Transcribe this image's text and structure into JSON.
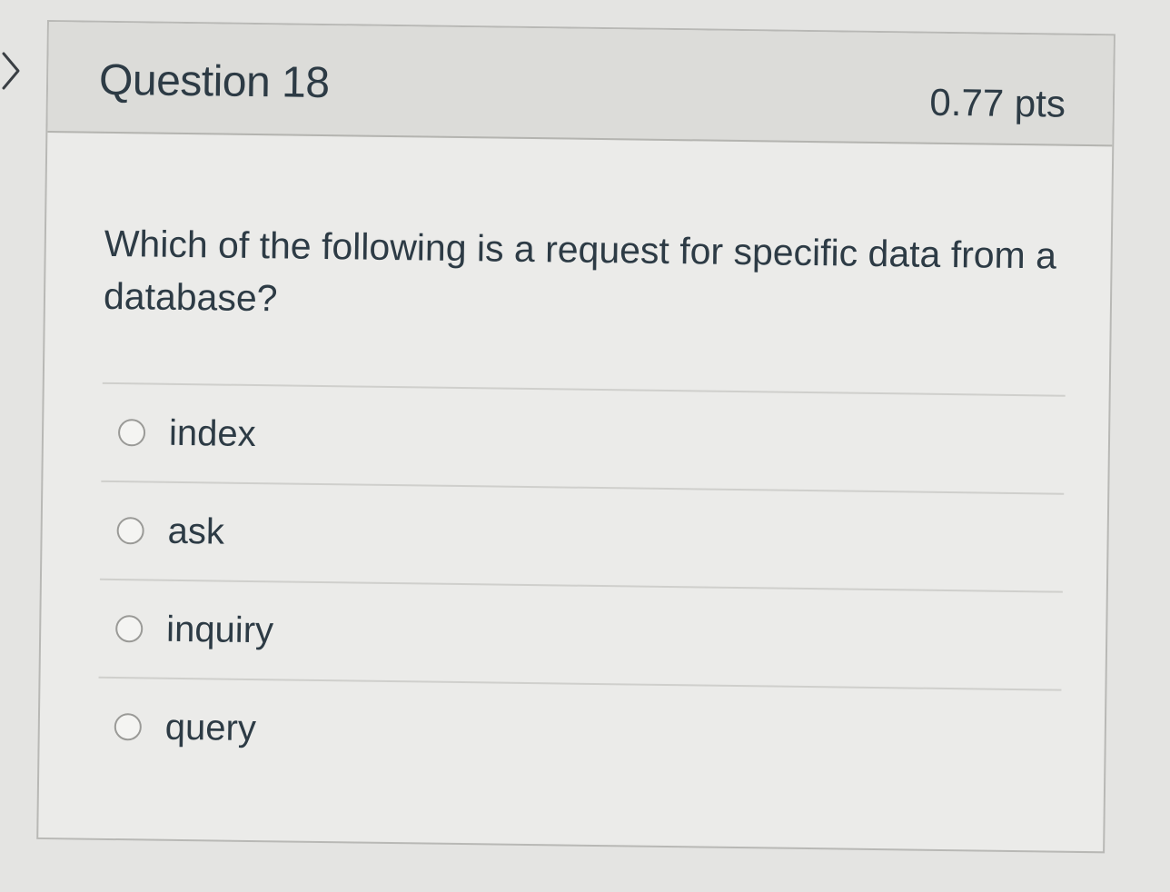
{
  "nav": {
    "icon": "chevron-right-icon"
  },
  "question": {
    "title": "Question 18",
    "points": "0.77 pts",
    "text": "Which of the following is a request for specific data from a database?",
    "answers": [
      {
        "label": "index",
        "selected": false
      },
      {
        "label": "ask",
        "selected": false
      },
      {
        "label": "inquiry",
        "selected": false
      },
      {
        "label": "query",
        "selected": false
      }
    ]
  },
  "colors": {
    "text": "#2d3b45",
    "header_bg": "#dcdcd9",
    "card_bg": "#ebebe9",
    "border": "#b8b8b5"
  }
}
